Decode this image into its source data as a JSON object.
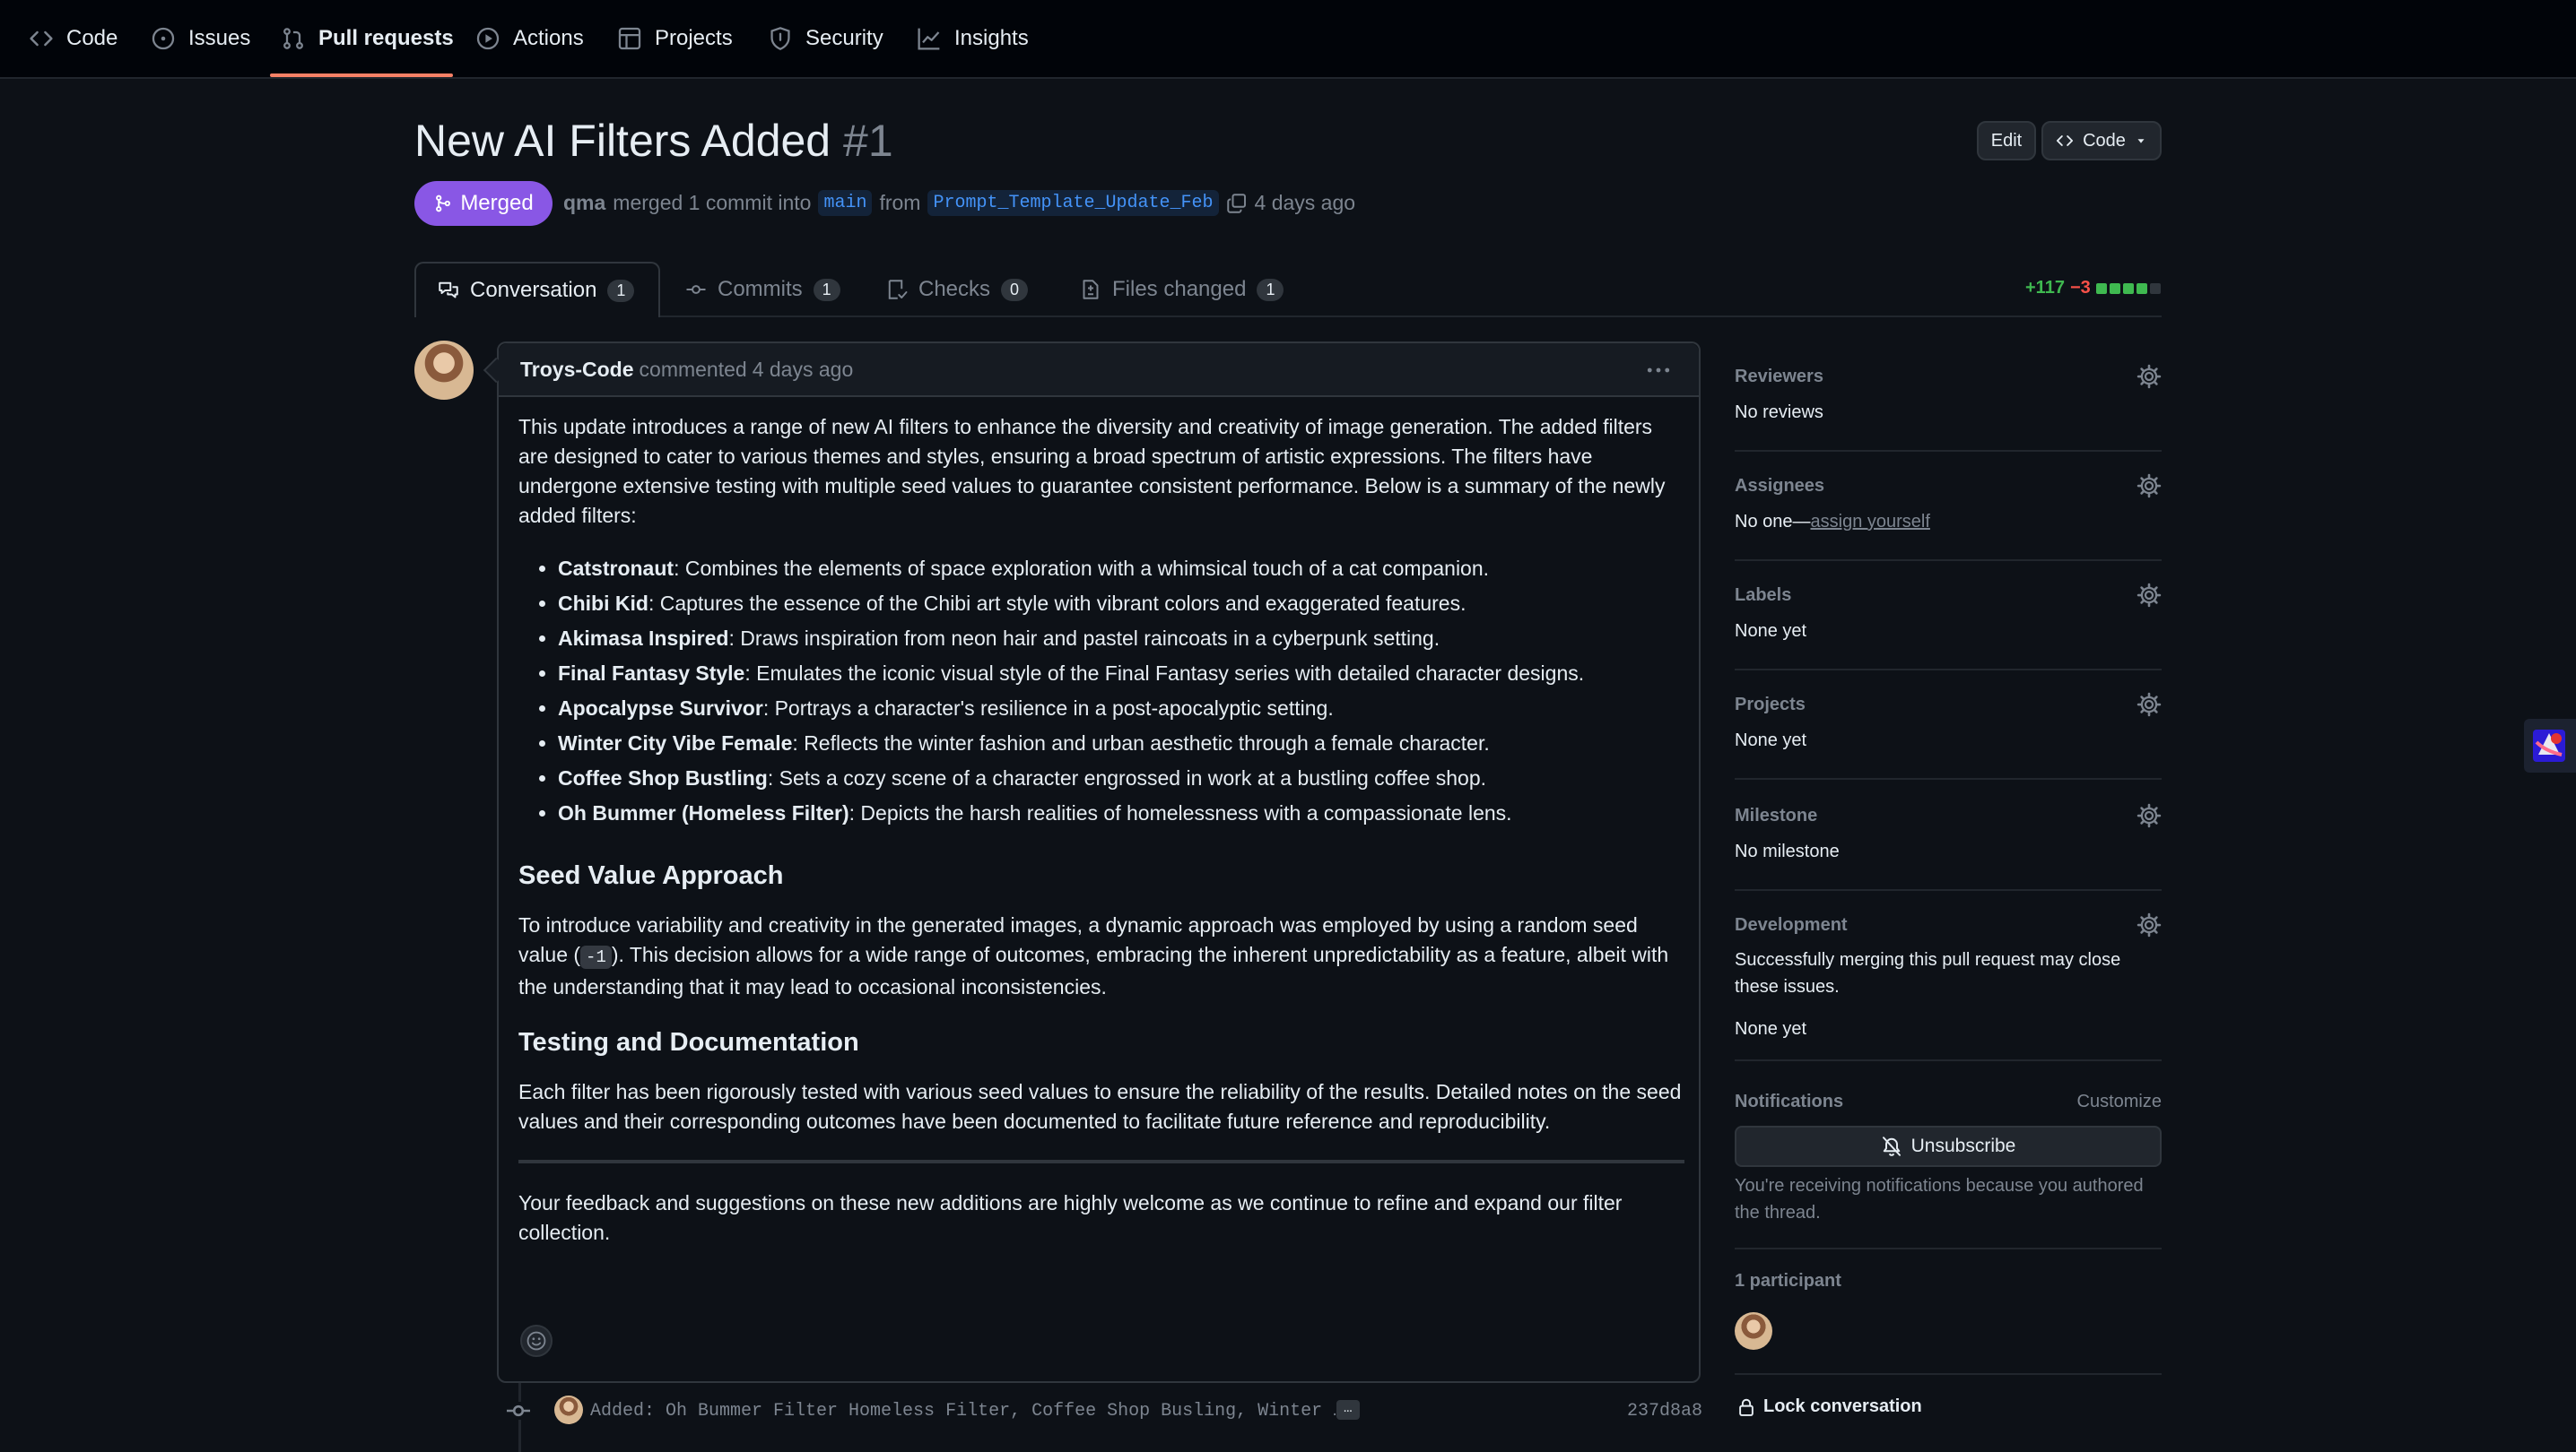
{
  "repo_nav": {
    "items": [
      {
        "label": "Code",
        "icon": "code-icon"
      },
      {
        "label": "Issues",
        "icon": "issue-opened-icon"
      },
      {
        "label": "Pull requests",
        "icon": "git-pull-request-icon"
      },
      {
        "label": "Actions",
        "icon": "play-icon"
      },
      {
        "label": "Projects",
        "icon": "table-icon"
      },
      {
        "label": "Security",
        "icon": "shield-icon"
      },
      {
        "label": "Insights",
        "icon": "graph-icon"
      }
    ],
    "active": "Pull requests"
  },
  "pr": {
    "title": "New AI Filters Added",
    "number": "#1",
    "state": "Merged",
    "merged_by": "qma",
    "merge_text": "merged 1 commit into",
    "base_branch": "main",
    "from_text": "from",
    "head_branch": "Prompt_Template_Update_Feb",
    "time": "4 days ago",
    "edit_label": "Edit",
    "code_label": "Code"
  },
  "tabs": [
    {
      "label": "Conversation",
      "count": "1",
      "icon": "comment-discussion-icon"
    },
    {
      "label": "Commits",
      "count": "1",
      "icon": "git-commit-icon"
    },
    {
      "label": "Checks",
      "count": "0",
      "icon": "checklist-icon"
    },
    {
      "label": "Files changed",
      "count": "1",
      "icon": "file-diff-icon"
    }
  ],
  "diffstat": {
    "additions": "+117",
    "deletions": "−3",
    "blocks": [
      "green",
      "green",
      "green",
      "green",
      "gray"
    ]
  },
  "colors": {
    "accent_merged": "#8957e5",
    "underline": "#f78166",
    "add": "#3fb950",
    "del": "#f85149",
    "link": "#4493f8"
  },
  "comment": {
    "author": "Troys-Code",
    "action": "commented",
    "time": "4 days ago",
    "intro": "This update introduces a range of new AI filters to enhance the diversity and creativity of image generation. The added filters are designed to cater to various themes and styles, ensuring a broad spectrum of artistic expressions. The filters have undergone extensive testing with multiple seed values to guarantee consistent performance. Below is a summary of the newly added filters:",
    "filters": [
      {
        "name": "Catstronaut",
        "desc": ": Combines the elements of space exploration with a whimsical touch of a cat companion."
      },
      {
        "name": "Chibi Kid",
        "desc": ": Captures the essence of the Chibi art style with vibrant colors and exaggerated features."
      },
      {
        "name": "Akimasa Inspired",
        "desc": ": Draws inspiration from neon hair and pastel raincoats in a cyberpunk setting."
      },
      {
        "name": "Final Fantasy Style",
        "desc": ": Emulates the iconic visual style of the Final Fantasy series with detailed character designs."
      },
      {
        "name": "Apocalypse Survivor",
        "desc": ": Portrays a character's resilience in a post-apocalyptic setting."
      },
      {
        "name": "Winter City Vibe Female",
        "desc": ": Reflects the winter fashion and urban aesthetic through a female character."
      },
      {
        "name": "Coffee Shop Bustling",
        "desc": ": Sets a cozy scene of a character engrossed in work at a bustling coffee shop."
      },
      {
        "name": "Oh Bummer (Homeless Filter)",
        "desc": ": Depicts the harsh realities of homelessness with a compassionate lens."
      }
    ],
    "h_seed": "Seed Value Approach",
    "seed_before": "To introduce variability and creativity in the generated images, a dynamic approach was employed by using a random seed value (",
    "seed_code": "-1",
    "seed_after": "). This decision allows for a wide range of outcomes, embracing the inherent unpredictability as a feature, albeit with the understanding that it may lead to occasional inconsistencies.",
    "h_testing": "Testing and Documentation",
    "testing": "Each filter has been rigorously tested with various seed values to ensure the reliability of the results. Detailed notes on the seed values and their corresponding outcomes have been documented to facilitate future reference and reproducibility.",
    "feedback": "Your feedback and suggestions on these new additions are highly welcome as we continue to refine and expand our filter collection."
  },
  "commit": {
    "message": "Added: Oh Bummer Filter Homeless Filter, Coffee Shop Busling, Winter …",
    "ellipsis": "…",
    "sha": "237d8a8"
  },
  "sidebar": {
    "reviewers": {
      "title": "Reviewers",
      "value": "No reviews"
    },
    "assignees": {
      "title": "Assignees",
      "value": "No one—",
      "link": "assign yourself"
    },
    "labels": {
      "title": "Labels",
      "value": "None yet"
    },
    "projects": {
      "title": "Projects",
      "value": "None yet"
    },
    "milestone": {
      "title": "Milestone",
      "value": "No milestone"
    },
    "development": {
      "title": "Development",
      "desc": "Successfully merging this pull request may close these issues.",
      "value": "None yet"
    },
    "notifications": {
      "title": "Notifications",
      "customize": "Customize",
      "button": "Unsubscribe",
      "reason": "You're receiving notifications because you authored the thread."
    },
    "participants": {
      "title": "1 participant"
    },
    "lock": "Lock conversation"
  }
}
